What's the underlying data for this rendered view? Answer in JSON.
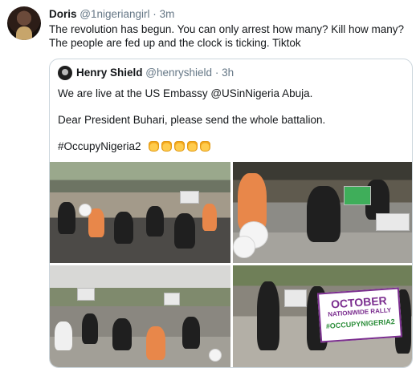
{
  "tweet": {
    "name": "Doris",
    "handle": "@1nigeriangirl",
    "separator": "·",
    "time": "3m",
    "text": "The revolution has begun. You can only arrest how many? Kill how many?\nThe people are fed up and the clock is ticking. Tiktok"
  },
  "quoted": {
    "name": "Henry Shield",
    "handle": "@henryshield",
    "separator": "·",
    "time": "3h",
    "line1": "We are live at the US Embassy @USinNigeria Abuja.",
    "line2": "Dear President Buhari, please send the whole battalion.",
    "hashtag": "#OccupyNigeria2",
    "emoji": [
      "oncoming-fist-icon",
      "oncoming-fist-icon",
      "oncoming-fist-icon",
      "oncoming-fist-icon",
      "oncoming-fist-icon"
    ]
  },
  "photos": [
    {
      "name": "protesters-seated-on-road"
    },
    {
      "name": "protester-sitting-with-balloons"
    },
    {
      "name": "protesters-sitting-near-embassy"
    },
    {
      "name": "protesters-with-banner",
      "banner_line1": "OCTOBER",
      "banner_line2": "NATIONWIDE RALLY",
      "banner_line3": "#OCCUPYNIGERIA2"
    }
  ],
  "colors": {
    "text": "#14171a",
    "muted": "#657786",
    "border": "#ccd6dd",
    "banner_purple": "#7b2e8f",
    "banner_green": "#2e8f3c"
  }
}
